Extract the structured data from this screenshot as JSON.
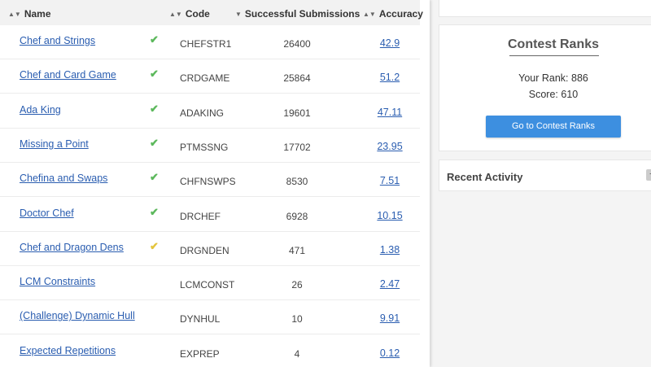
{
  "table": {
    "headers": {
      "name": "Name",
      "code": "Code",
      "submissions": "Successful Submissions",
      "accuracy": "Accuracy"
    },
    "rows": [
      {
        "name": "Chef and Strings",
        "solved": "full",
        "code": "CHEFSTR1",
        "subs": "26400",
        "acc": "42.9"
      },
      {
        "name": "Chef and Card Game",
        "solved": "full",
        "code": "CRDGAME",
        "subs": "25864",
        "acc": "51.2"
      },
      {
        "name": "Ada King",
        "solved": "full",
        "code": "ADAKING",
        "subs": "19601",
        "acc": "47.11"
      },
      {
        "name": "Missing a Point",
        "solved": "full",
        "code": "PTMSSNG",
        "subs": "17702",
        "acc": "23.95"
      },
      {
        "name": "Chefina and Swaps",
        "solved": "full",
        "code": "CHFNSWPS",
        "subs": "8530",
        "acc": "7.51"
      },
      {
        "name": "Doctor Chef",
        "solved": "full",
        "code": "DRCHEF",
        "subs": "6928",
        "acc": "10.15"
      },
      {
        "name": "Chef and Dragon Dens",
        "solved": "partial",
        "code": "DRGNDEN",
        "subs": "471",
        "acc": "1.38"
      },
      {
        "name": "LCM Constraints",
        "solved": "none",
        "code": "LCMCONST",
        "subs": "26",
        "acc": "2.47"
      },
      {
        "name": "(Challenge) Dynamic Hull",
        "solved": "none",
        "code": "DYNHUL",
        "subs": "10",
        "acc": "9.91"
      },
      {
        "name": "Expected Repetitions",
        "solved": "none",
        "code": "EXPREP",
        "subs": "4",
        "acc": "0.12"
      }
    ]
  },
  "contest_ranks": {
    "title": "Contest Ranks",
    "rank_text": "Your Rank: 886",
    "score_text": "Score: 610",
    "button_label": "Go to Contest Ranks"
  },
  "recent_activity": {
    "title": "Recent Activity",
    "collapse_glyph": "−"
  },
  "icons": {
    "sort": "sort-arrows-icon",
    "sort_desc": "sort-desc-icon",
    "check": "check-icon"
  },
  "colors": {
    "link": "#2a5db0",
    "check_full": "#5cb85c",
    "check_partial": "#e3c43c",
    "button": "#3d8fe0"
  }
}
